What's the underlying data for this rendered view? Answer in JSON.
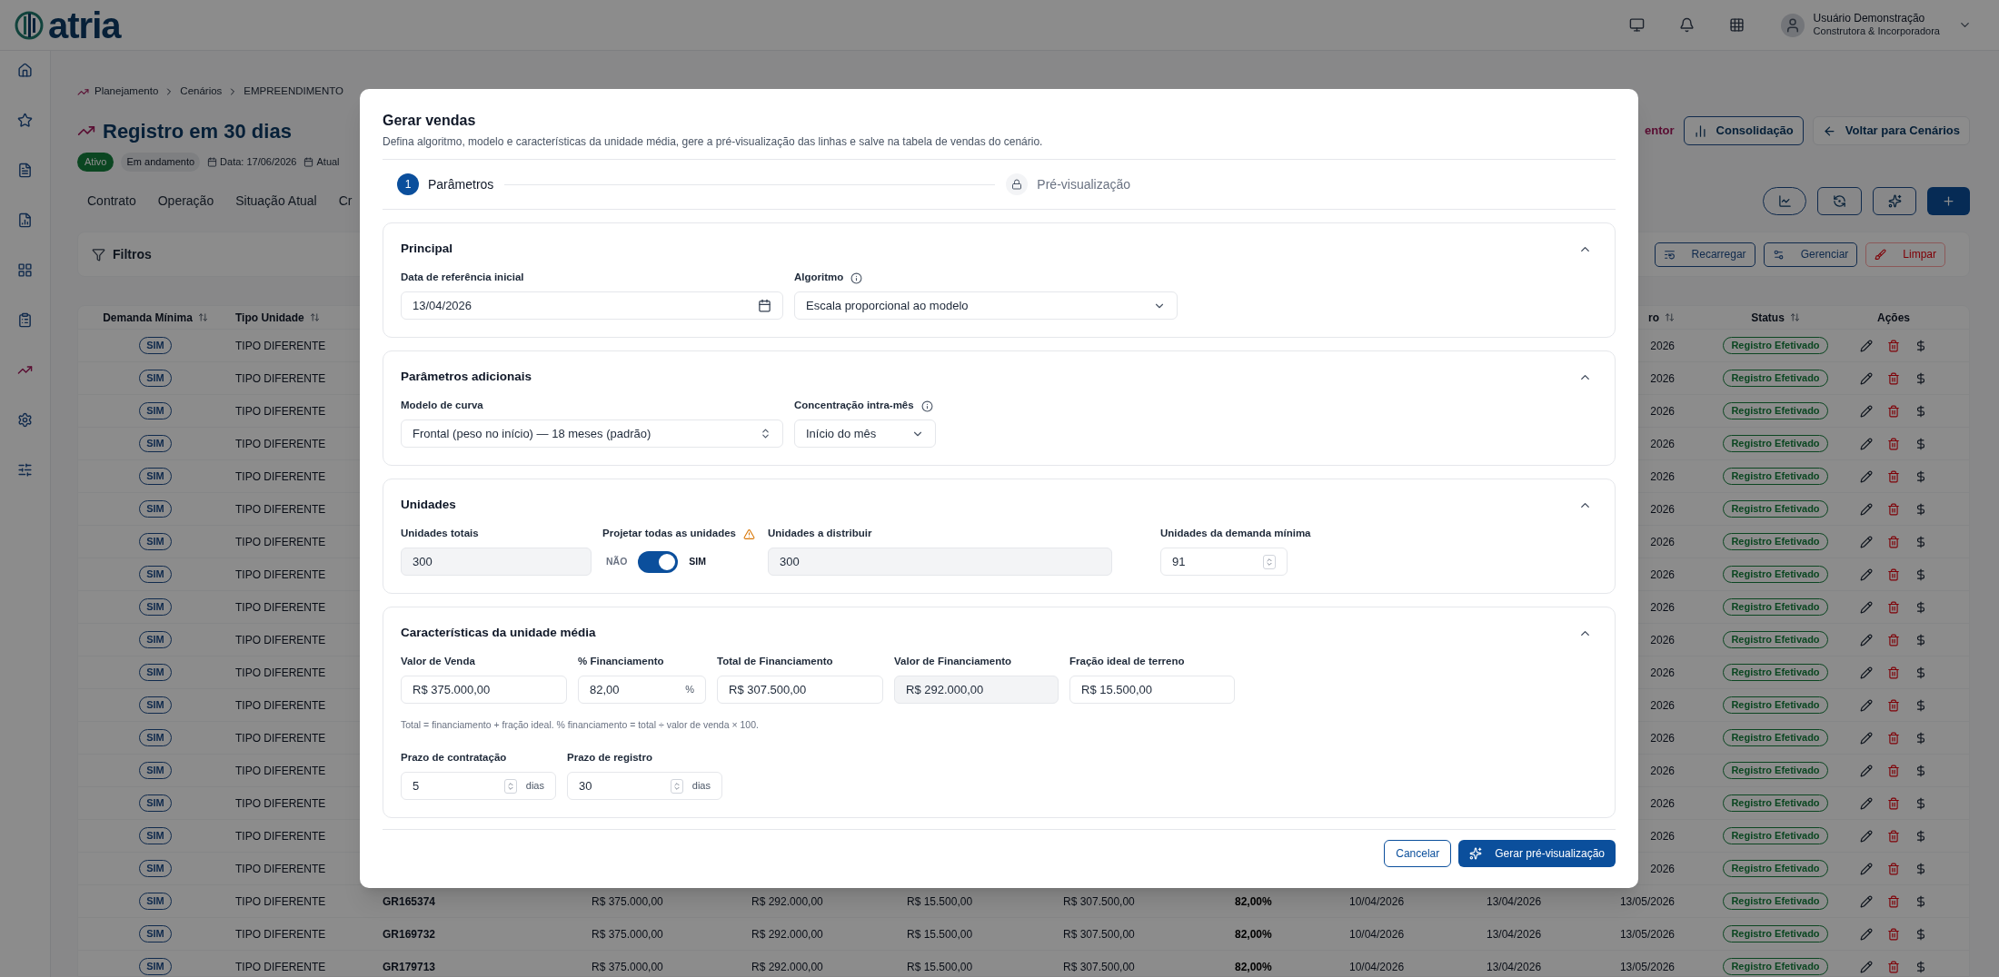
{
  "topbar": {
    "logo": "atria",
    "user": {
      "name": "Usuário Demonstração",
      "company": "Construtora & Incorporadora"
    }
  },
  "sidebar": {
    "items": [
      {
        "selected": false
      },
      {
        "selected": false
      },
      {
        "selected": false
      },
      {
        "selected": false
      },
      {
        "selected": false
      },
      {
        "selected": false
      },
      {
        "selected": true
      },
      {
        "selected": false
      },
      {
        "selected": false
      }
    ]
  },
  "breadcrumb": [
    "Planejamento",
    "Cenários",
    "EMPREENDIMENTO"
  ],
  "page": {
    "title": "Registro em 30 dias",
    "status": "Ativo",
    "phase": "Em andamento",
    "date": "Data: 17/06/2026",
    "updated": "Atual",
    "tag": "entor",
    "buttons": [
      {
        "label": "Consolidação",
        "kind": "outline"
      },
      {
        "label": "Voltar para Cenários",
        "kind": "ghost"
      }
    ]
  },
  "tabs": [
    {
      "label": "Contrato",
      "selected": false
    },
    {
      "label": "Operação",
      "selected": false
    },
    {
      "label": "Situação Atual",
      "selected": false
    },
    {
      "label": "Cr",
      "selected": false
    }
  ],
  "filters": {
    "title": "Filtros",
    "buttons": [
      {
        "label": "Recarregar",
        "disabled": false
      },
      {
        "label": "Gerenciar",
        "disabled": false
      },
      {
        "label": "Limpar",
        "disabled": true
      }
    ]
  },
  "table": {
    "columns": [
      {
        "label": "Demanda Mínima",
        "sortable": true
      },
      {
        "label": "Tipo Unidade",
        "sortable": true
      },
      {
        "label": "ro",
        "sortable": true
      },
      {
        "label": "Status",
        "sortable": true
      },
      {
        "label": "Ações",
        "sortable": false
      }
    ],
    "rows": [
      {
        "demanda": "SIM",
        "tipo": "TIPO DIFERENTE",
        "column_11": "2026",
        "status": "Registro Efetivado"
      },
      {
        "demanda": "SIM",
        "tipo": "TIPO DIFERENTE",
        "column_11": "2026",
        "status": "Registro Efetivado"
      },
      {
        "demanda": "SIM",
        "tipo": "TIPO DIFERENTE",
        "column_11": "2026",
        "status": "Registro Efetivado"
      },
      {
        "demanda": "SIM",
        "tipo": "TIPO DIFERENTE",
        "column_11": "2026",
        "status": "Registro Efetivado"
      },
      {
        "demanda": "SIM",
        "tipo": "TIPO DIFERENTE",
        "column_11": "2026",
        "status": "Registro Efetivado"
      },
      {
        "demanda": "SIM",
        "tipo": "TIPO DIFERENTE",
        "column_11": "2026",
        "status": "Registro Efetivado"
      },
      {
        "demanda": "SIM",
        "tipo": "TIPO DIFERENTE",
        "column_11": "2026",
        "status": "Registro Efetivado"
      },
      {
        "demanda": "SIM",
        "tipo": "TIPO DIFERENTE",
        "column_11": "2026",
        "status": "Registro Efetivado"
      },
      {
        "demanda": "SIM",
        "tipo": "TIPO DIFERENTE",
        "column_11": "2026",
        "status": "Registro Efetivado"
      },
      {
        "demanda": "SIM",
        "tipo": "TIPO DIFERENTE",
        "column_11": "2026",
        "status": "Registro Efetivado"
      },
      {
        "demanda": "SIM",
        "tipo": "TIPO DIFERENTE",
        "column_11": "2026",
        "status": "Registro Efetivado"
      },
      {
        "demanda": "SIM",
        "tipo": "TIPO DIFERENTE",
        "column_11": "2026",
        "status": "Registro Efetivado"
      },
      {
        "demanda": "SIM",
        "tipo": "TIPO DIFERENTE",
        "column_11": "2026",
        "status": "Registro Efetivado"
      },
      {
        "demanda": "SIM",
        "tipo": "TIPO DIFERENTE",
        "column_11": "2026",
        "status": "Registro Efetivado"
      },
      {
        "demanda": "SIM",
        "tipo": "TIPO DIFERENTE",
        "column_11": "2026",
        "status": "Registro Efetivado"
      },
      {
        "demanda": "SIM",
        "tipo": "TIPO DIFERENTE",
        "column_11": "2026",
        "status": "Registro Efetivado"
      },
      {
        "demanda": "SIM",
        "tipo": "TIPO DIFERENTE",
        "column_11": "2026",
        "status": "Registro Efetivado"
      },
      {
        "demanda": "SIM",
        "tipo": "TIPO DIFERENTE",
        "column_3": "GR165374",
        "column_4": "R$ 375.000,00",
        "column_5": "R$ 292.000,00",
        "column_6": "R$ 15.500,00",
        "column_7": "R$ 307.500,00",
        "column_8": "82,00%",
        "column_9": "10/04/2026",
        "column_10": "13/04/2026",
        "column_11": "13/05/2026",
        "status": "Registro Efetivado"
      },
      {
        "demanda": "SIM",
        "tipo": "TIPO DIFERENTE",
        "column_3": "GR169732",
        "column_4": "R$ 375.000,00",
        "column_5": "R$ 292.000,00",
        "column_6": "R$ 15.500,00",
        "column_7": "R$ 307.500,00",
        "column_8": "82,00%",
        "column_9": "10/04/2026",
        "column_10": "13/04/2026",
        "column_11": "13/05/2026",
        "status": "Registro Efetivado"
      },
      {
        "demanda": "SIM",
        "tipo": "TIPO DIFERENTE",
        "column_3": "GR179713",
        "column_4": "R$ 375.000,00",
        "column_5": "R$ 292.000,00",
        "column_6": "R$ 15.500,00",
        "column_7": "R$ 307.500,00",
        "column_8": "82,00%",
        "column_9": "10/04/2026",
        "column_10": "13/04/2026",
        "column_11": "13/05/2026",
        "status": "Registro Efetivado"
      }
    ]
  },
  "dialog": {
    "title": "Gerar vendas",
    "description": "Defina algoritmo, modelo e características da unidade média, gere a pré-visualização das linhas e salve na tabela de vendas do cenário.",
    "steps": [
      {
        "number": "1",
        "label": "Parâmetros",
        "active": true
      },
      {
        "label": "Pré-visualização",
        "active": false
      }
    ],
    "sections": [
      {
        "title": "Principal",
        "expanded": true,
        "rows": [
          {
            "kind": "fields",
            "fields": [
              {
                "kind": "date",
                "label": "Data de referência inicial",
                "value": "13/04/2026"
              },
              {
                "kind": "select",
                "label": "Algoritmo",
                "info_icon": true,
                "value": "Escala proporcional ao modelo"
              }
            ]
          }
        ]
      },
      {
        "title": "Parâmetros adicionais",
        "expanded": true,
        "rows": [
          {
            "kind": "fields",
            "fields": [
              {
                "kind": "combobox",
                "label": "Modelo de curva",
                "value": "Frontal (peso no início) — 18 meses (padrão)"
              },
              {
                "kind": "select",
                "label": "Concentração intra-mês",
                "info_icon": true,
                "value": "Início do mês"
              }
            ]
          }
        ]
      },
      {
        "title": "Unidades",
        "expanded": true,
        "rows": [
          {
            "kind": "fields",
            "fields": [
              {
                "kind": "text",
                "label": "Unidades totais",
                "value": "300",
                "readonly": true
              },
              {
                "kind": "switch",
                "label": "Projetar todas as unidades",
                "warning_icon": true,
                "off_label": "NÃO",
                "on_label": "SIM",
                "on": true
              },
              {
                "kind": "text",
                "label": "Unidades a distribuir",
                "value": "300",
                "readonly": true
              },
              {
                "kind": "number",
                "label": "Unidades da demanda mínima",
                "value": "91"
              }
            ]
          }
        ]
      },
      {
        "title": "Características da unidade média",
        "expanded": true,
        "rows": [
          {
            "kind": "fields",
            "fields": [
              {
                "kind": "text",
                "label": "Valor de Venda",
                "value": "R$ 375.000,00",
                "readonly": false
              },
              {
                "kind": "text",
                "label": "% Financiamento",
                "value": "82,00",
                "suffix": "%",
                "readonly": false
              },
              {
                "kind": "text",
                "label": "Total de Financiamento",
                "value": "R$ 307.500,00",
                "readonly": false
              },
              {
                "kind": "text",
                "label": "Valor de Financiamento",
                "value": "R$ 292.000,00",
                "readonly": true
              },
              {
                "kind": "text",
                "label": "Fração ideal de terreno",
                "value": "R$ 15.500,00",
                "readonly": false
              }
            ]
          },
          {
            "kind": "note",
            "text": "Total = financiamento + fração ideal. % financiamento = total ÷ valor de venda × 100."
          },
          {
            "kind": "fields",
            "fields": [
              {
                "kind": "number",
                "label": "Prazo de contratação",
                "value": "5",
                "suffix": "dias"
              },
              {
                "kind": "number",
                "label": "Prazo de registro",
                "value": "30",
                "suffix": "dias"
              }
            ]
          }
        ]
      }
    ],
    "actions": [
      {
        "label": "Cancelar",
        "kind": "secondary"
      },
      {
        "label": "Gerar pré-visualização",
        "kind": "primary"
      }
    ]
  }
}
